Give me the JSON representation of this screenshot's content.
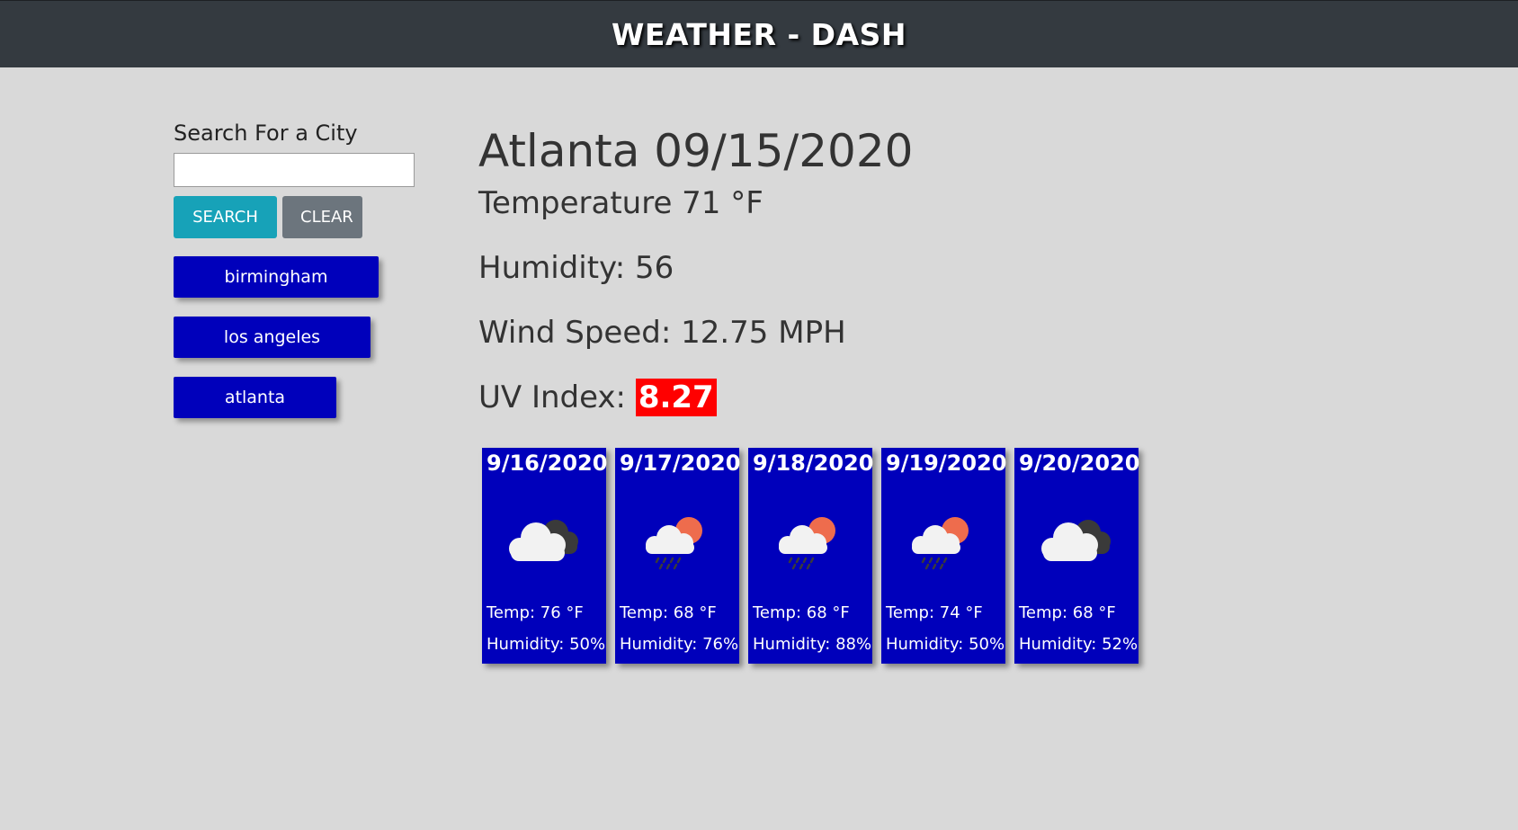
{
  "header": {
    "title": "WEATHER - DASH"
  },
  "search": {
    "label": "Search For a City",
    "placeholder": "",
    "value": "",
    "search_label": "SEARCH",
    "clear_label": "CLEAR"
  },
  "history": [
    {
      "label": "birmingham"
    },
    {
      "label": "los angeles"
    },
    {
      "label": "atlanta"
    }
  ],
  "current": {
    "title": "Atlanta 09/15/2020",
    "temperature": "Temperature 71 °F",
    "humidity": "Humidity: 56",
    "wind": "Wind Speed: 12.75 MPH",
    "uv_label": "UV Index: ",
    "uv_value": "8.27",
    "uv_color": "#ff0000"
  },
  "forecast": [
    {
      "date": "9/16/2020",
      "icon": "broken-clouds-icon",
      "temp": "Temp: 76 °F",
      "humidity": "Humidity: 50%"
    },
    {
      "date": "9/17/2020",
      "icon": "rain-sun-icon",
      "temp": "Temp: 68 °F",
      "humidity": "Humidity: 76%"
    },
    {
      "date": "9/18/2020",
      "icon": "rain-sun-icon",
      "temp": "Temp: 68 °F",
      "humidity": "Humidity: 88%"
    },
    {
      "date": "9/19/2020",
      "icon": "rain-sun-icon",
      "temp": "Temp: 74 °F",
      "humidity": "Humidity: 50%"
    },
    {
      "date": "9/20/2020",
      "icon": "broken-clouds-icon",
      "temp": "Temp: 68 °F",
      "humidity": "Humidity: 52%"
    }
  ],
  "colors": {
    "header_bg": "#343a40",
    "page_bg": "#d9d9d9",
    "card_bg": "#0000bb",
    "search_btn": "#17a2b8",
    "clear_btn": "#6c757d"
  }
}
